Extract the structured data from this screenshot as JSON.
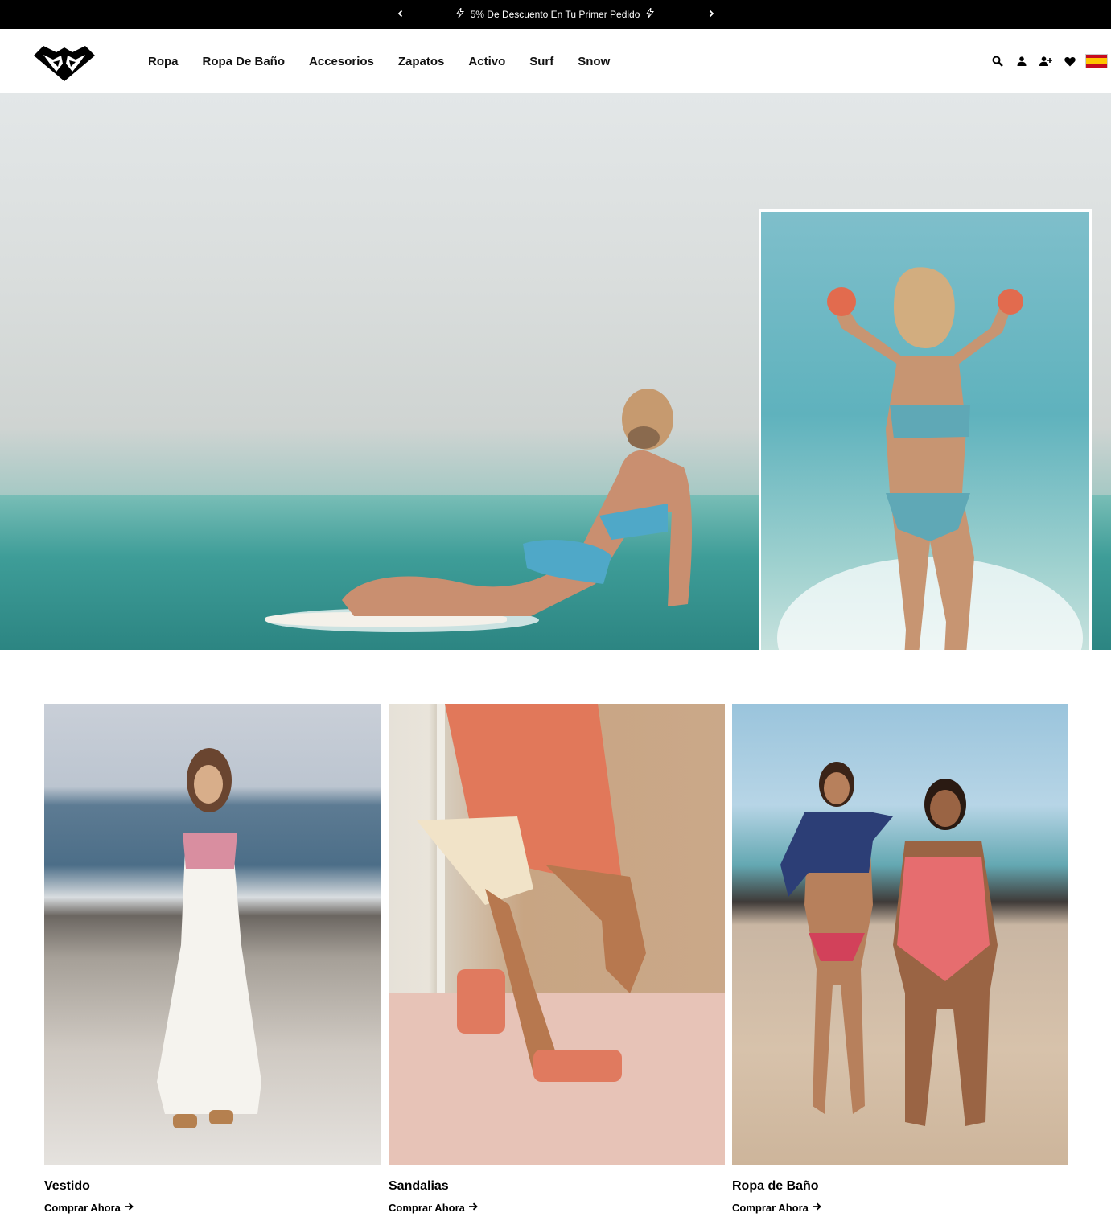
{
  "promo": {
    "message": "5% De Descuento En Tu Primer Pedido",
    "prev_icon": "chevron-left-icon",
    "next_icon": "chevron-right-icon",
    "background": "#000000"
  },
  "header": {
    "logo": "roxy-heart-logo",
    "nav": [
      "Ropa",
      "Ropa De Baño",
      "Accesorios",
      "Zapatos",
      "Activo",
      "Surf",
      "Snow"
    ],
    "icons": [
      "search-icon",
      "account-icon",
      "register-icon",
      "wishlist-heart-icon",
      "spain-flag-icon"
    ]
  },
  "hero": {
    "image": "surfer-paddling-ocean",
    "inset_image": "woman-splashing-water-bikini"
  },
  "categories": [
    {
      "title": "Vestido",
      "cta": "Comprar Ahora",
      "image": "white-maxi-dress-beach"
    },
    {
      "title": "Sandalias",
      "cta": "Comprar Ahora",
      "image": "coral-platform-sandals"
    },
    {
      "title": "Ropa de Baño",
      "cta": "Comprar Ahora",
      "image": "women-swimwear-beach"
    }
  ]
}
